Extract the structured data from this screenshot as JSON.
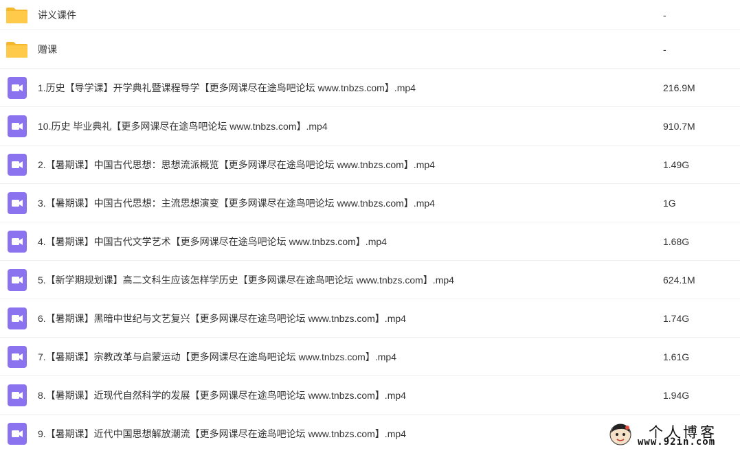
{
  "colors": {
    "folder": "#ffc94a",
    "folder_tab": "#f5b72c",
    "video": "#8b73f0",
    "divider": "#eef0f4",
    "text": "#333333"
  },
  "files": [
    {
      "name": "讲义课件",
      "size": "-",
      "icon": "folder-icon"
    },
    {
      "name": "赠课",
      "size": "-",
      "icon": "folder-icon"
    },
    {
      "name": "1.历史【导学课】开学典礼暨课程导学【更多网课尽在途鸟吧论坛 www.tnbzs.com】.mp4",
      "size": "216.9M",
      "icon": "video-file-icon"
    },
    {
      "name": "10.历史 毕业典礼【更多网课尽在途鸟吧论坛 www.tnbzs.com】.mp4",
      "size": "910.7M",
      "icon": "video-file-icon"
    },
    {
      "name": "2.【暑期课】中国古代思想：思想流派概览【更多网课尽在途鸟吧论坛 www.tnbzs.com】.mp4",
      "size": "1.49G",
      "icon": "video-file-icon"
    },
    {
      "name": "3.【暑期课】中国古代思想：主流思想演变【更多网课尽在途鸟吧论坛 www.tnbzs.com】.mp4",
      "size": "1G",
      "icon": "video-file-icon"
    },
    {
      "name": "4.【暑期课】中国古代文学艺术【更多网课尽在途鸟吧论坛 www.tnbzs.com】.mp4",
      "size": "1.68G",
      "icon": "video-file-icon"
    },
    {
      "name": "5.【新学期规划课】高二文科生应该怎样学历史【更多网课尽在途鸟吧论坛 www.tnbzs.com】.mp4",
      "size": "624.1M",
      "icon": "video-file-icon"
    },
    {
      "name": "6.【暑期课】黑暗中世纪与文艺复兴【更多网课尽在途鸟吧论坛 www.tnbzs.com】.mp4",
      "size": "1.74G",
      "icon": "video-file-icon"
    },
    {
      "name": "7.【暑期课】宗教改革与启蒙运动【更多网课尽在途鸟吧论坛 www.tnbzs.com】.mp4",
      "size": "1.61G",
      "icon": "video-file-icon"
    },
    {
      "name": "8.【暑期课】近现代自然科学的发展【更多网课尽在途鸟吧论坛 www.tnbzs.com】.mp4",
      "size": "1.94G",
      "icon": "video-file-icon"
    },
    {
      "name": "9.【暑期课】近代中国思想解放潮流【更多网课尽在途鸟吧论坛 www.tnbzs.com】.mp4",
      "size": "",
      "icon": "video-file-icon"
    }
  ],
  "watermark": {
    "title": "个人博客",
    "url": "www.92in.com"
  }
}
